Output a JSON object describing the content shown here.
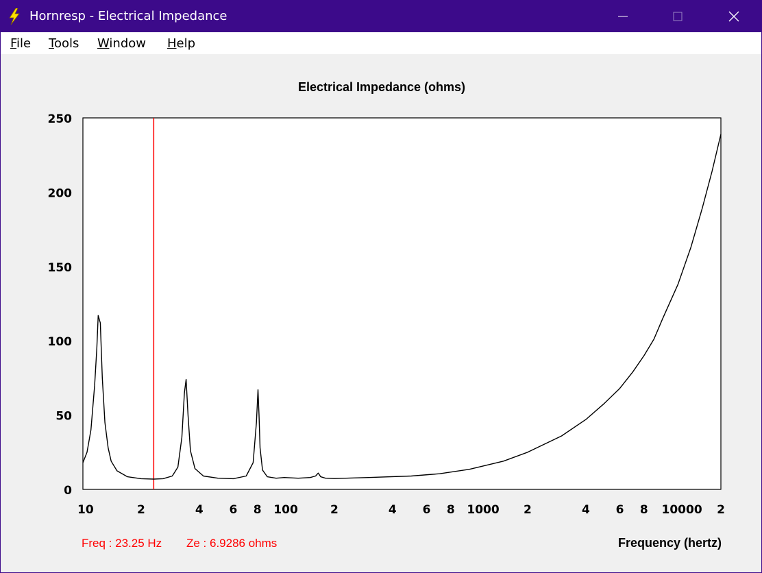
{
  "window": {
    "title": "Hornresp - Electrical Impedance",
    "icon": "lightning-bolt-icon",
    "controls": [
      "minimize-icon",
      "maximize-icon",
      "close-icon"
    ]
  },
  "menu": {
    "items": [
      "File",
      "Tools",
      "Window",
      "Help"
    ]
  },
  "status": {
    "freq": "Freq : 23.25 Hz",
    "ze": "Ze : 6.9286 ohms"
  },
  "colors": {
    "titlebar": "#3c0a8a",
    "curve": "#000000",
    "cursor": "#ff0000",
    "grid": "#c8c8c8"
  },
  "chart_data": {
    "type": "line",
    "title": "Electrical Impedance (ohms)",
    "xlabel": "Frequency (hertz)",
    "ylabel": "",
    "x_scale": "log",
    "xlim": [
      10,
      20000
    ],
    "ylim": [
      0,
      250
    ],
    "y_ticks": [
      0,
      50,
      100,
      150,
      200,
      250
    ],
    "x_tick_labels": [
      {
        "value": 10,
        "label": "10"
      },
      {
        "value": 20,
        "label": "2"
      },
      {
        "value": 40,
        "label": "4"
      },
      {
        "value": 60,
        "label": "6"
      },
      {
        "value": 80,
        "label": "8"
      },
      {
        "value": 100,
        "label": "100"
      },
      {
        "value": 200,
        "label": "2"
      },
      {
        "value": 400,
        "label": "4"
      },
      {
        "value": 600,
        "label": "6"
      },
      {
        "value": 800,
        "label": "8"
      },
      {
        "value": 1000,
        "label": "1000"
      },
      {
        "value": 2000,
        "label": "2"
      },
      {
        "value": 4000,
        "label": "4"
      },
      {
        "value": 6000,
        "label": "6"
      },
      {
        "value": 8000,
        "label": "8"
      },
      {
        "value": 10000,
        "label": "10000"
      },
      {
        "value": 20000,
        "label": "2"
      }
    ],
    "grid": true,
    "cursor_x": 23.25,
    "series": [
      {
        "x": [
          10,
          10.5,
          11,
          11.5,
          11.8,
          12,
          12.3,
          12.6,
          13,
          13.5,
          14,
          15,
          17,
          20,
          23.25,
          26,
          29,
          31,
          32.5,
          33.5,
          34.2,
          35,
          36,
          38,
          42,
          50,
          60,
          70,
          76,
          79,
          80.5,
          81.5,
          82.5,
          85,
          90,
          100,
          110,
          130,
          150,
          160,
          165,
          170,
          180,
          200,
          300,
          500,
          700,
          1000,
          1500,
          2000,
          3000,
          4000,
          5000,
          6000,
          7000,
          8000,
          9000,
          10000,
          12000,
          14000,
          16000,
          18000,
          20000
        ],
        "y": [
          18,
          25,
          40,
          70,
          95,
          117,
          112,
          75,
          45,
          28,
          19,
          12.5,
          8.5,
          7.2,
          6.93,
          7.2,
          9,
          15,
          35,
          65,
          74,
          50,
          26,
          14,
          9,
          7.5,
          7.2,
          9,
          18,
          45,
          67,
          50,
          28,
          13,
          8.5,
          7.5,
          8,
          7.5,
          8,
          9,
          11,
          8.5,
          7.5,
          7.3,
          8,
          9,
          10.5,
          13.5,
          19,
          25,
          36,
          47,
          58,
          68,
          79,
          90,
          101,
          115,
          138,
          163,
          189,
          214,
          239
        ]
      }
    ]
  }
}
